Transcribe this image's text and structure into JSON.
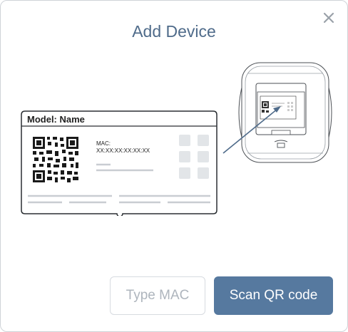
{
  "dialog": {
    "title": "Add Device",
    "close_icon": "close-icon"
  },
  "label_card": {
    "model_text": "Model: Name",
    "mac_label": "MAC:",
    "mac_value": "XX:XX:XX:XX:XX:XX"
  },
  "buttons": {
    "type_mac_label": "Type MAC",
    "scan_qr_label": "Scan QR code"
  },
  "colors": {
    "accent": "#56799f",
    "title": "#4f6b8a",
    "secondary_text": "#aeb5bd"
  }
}
